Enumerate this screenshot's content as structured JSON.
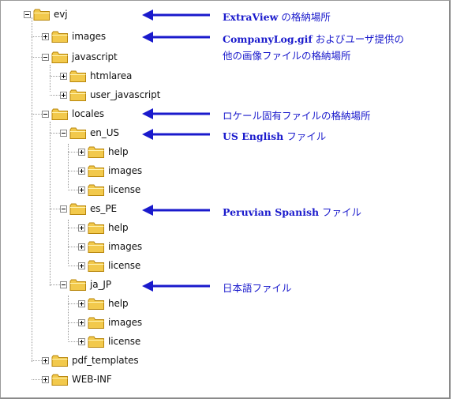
{
  "tree": [
    {
      "label": "evj",
      "state": "minus"
    },
    {
      "label": "images",
      "state": "plus"
    },
    {
      "label": "javascript",
      "state": "minus"
    },
    {
      "label": "htmlarea",
      "state": "plus"
    },
    {
      "label": "user_javascript",
      "state": "plus"
    },
    {
      "label": "locales",
      "state": "minus"
    },
    {
      "label": "en_US",
      "state": "minus"
    },
    {
      "label": "help",
      "state": "plus"
    },
    {
      "label": "images",
      "state": "plus"
    },
    {
      "label": "license",
      "state": "plus"
    },
    {
      "label": "es_PE",
      "state": "minus"
    },
    {
      "label": "help",
      "state": "plus"
    },
    {
      "label": "images",
      "state": "plus"
    },
    {
      "label": "license",
      "state": "plus"
    },
    {
      "label": "ja_JP",
      "state": "minus"
    },
    {
      "label": "help",
      "state": "plus"
    },
    {
      "label": "images",
      "state": "plus"
    },
    {
      "label": "license",
      "state": "plus"
    },
    {
      "label": "pdf_templates",
      "state": "plus"
    },
    {
      "label": "WEB-INF",
      "state": "plus"
    }
  ],
  "annotations": {
    "evj_prefix": "ExtraView",
    "evj_suffix": " の格納場所",
    "images_prefix": "CompanyLog.gif",
    "images_suffix": " およびユーザ提供の",
    "images_line2": "他の画像ファイルの格納場所",
    "locales": "ロケール固有ファイルの格納場所",
    "en_us_prefix": "US English",
    "en_us_suffix": " ファイル",
    "es_pe_prefix": "Peruvian Spanish",
    "es_pe_suffix": " ファイル",
    "ja_jp": "日本語ファイル"
  },
  "colors": {
    "arrow": "#1a1acc",
    "folder": "#f2c94c",
    "folder_edge": "#b8860b"
  },
  "icons": {
    "expander": "tree-expander-icon",
    "folder": "folder-icon",
    "arrow": "arrow-left-icon"
  }
}
